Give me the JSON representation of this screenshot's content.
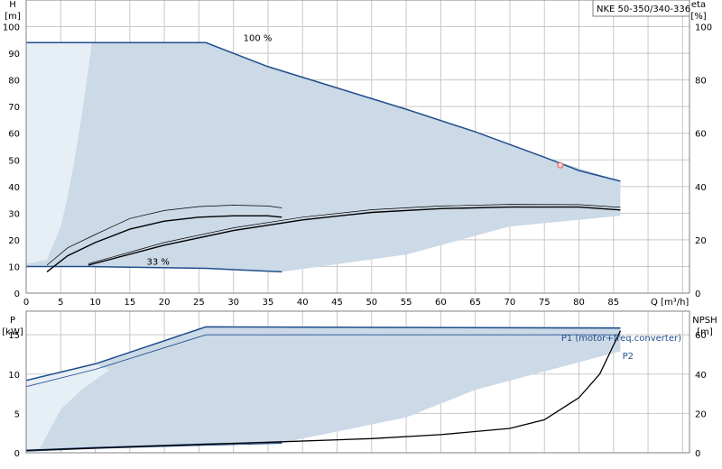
{
  "chart_data": [
    {
      "type": "area",
      "title": "NKE 50-350/340-336",
      "ylabel_unit": "[m]",
      "ylabel": "H",
      "xlabel": "Q [m³/h]",
      "right_ylabel": "eta",
      "right_ylabel_unit": "[%]",
      "xlim": [
        0,
        96
      ],
      "ylim": [
        0,
        110
      ],
      "right_ylim": [
        0,
        110
      ],
      "x_ticks": [
        0,
        5,
        10,
        15,
        20,
        25,
        30,
        35,
        40,
        45,
        50,
        55,
        60,
        65,
        70,
        75,
        80,
        85
      ],
      "y_ticks": [
        0,
        10,
        20,
        30,
        40,
        50,
        60,
        70,
        80,
        90,
        100
      ],
      "right_ticks": [
        0,
        20,
        40,
        60,
        80,
        100
      ],
      "grid": true,
      "annotations": [
        {
          "text": "100 %",
          "x": 33,
          "y": 96
        },
        {
          "text": "33 %",
          "x": 19,
          "y": 12
        }
      ],
      "operating_point": {
        "x": 77.3,
        "y": 48
      },
      "series": [
        {
          "role": "envelope",
          "points": [
            [
              0,
              94
            ],
            [
              26,
              94
            ],
            [
              35,
              85
            ],
            [
              45,
              77
            ],
            [
              55,
              69
            ],
            [
              65,
              60.5
            ],
            [
              75,
              51
            ],
            [
              86,
              42
            ],
            [
              86,
              29
            ],
            [
              70,
              25
            ],
            [
              55,
              14.5
            ],
            [
              37,
              8
            ],
            [
              26,
              9.3
            ],
            [
              9,
              10
            ],
            [
              0,
              10
            ]
          ]
        },
        {
          "role": "envelope_light",
          "points": [
            [
              0,
              94
            ],
            [
              9.5,
              94
            ],
            [
              9,
              84
            ],
            [
              8,
              66
            ],
            [
              7,
              50
            ],
            [
              6,
              36
            ],
            [
              5,
              25
            ],
            [
              3,
              12.5
            ],
            [
              0,
              11
            ]
          ]
        },
        {
          "role": "head_max",
          "points": [
            [
              0,
              94
            ],
            [
              26,
              94
            ],
            [
              35,
              85
            ],
            [
              45,
              77
            ],
            [
              55,
              69
            ],
            [
              65,
              60.5
            ],
            [
              75,
              51
            ],
            [
              80,
              46
            ],
            [
              86,
              42
            ]
          ]
        },
        {
          "role": "head_min",
          "points": [
            [
              0,
              10
            ],
            [
              9,
              10
            ],
            [
              26,
              9.3
            ],
            [
              37,
              8
            ]
          ]
        },
        {
          "role": "eta_max",
          "points": [
            [
              9,
              10.5
            ],
            [
              20,
              18
            ],
            [
              30,
              23.5
            ],
            [
              40,
              27.5
            ],
            [
              50,
              30.3
            ],
            [
              60,
              31.7
            ],
            [
              70,
              32.3
            ],
            [
              80,
              32.3
            ],
            [
              86,
              31.2
            ]
          ]
        },
        {
          "role": "eta_max_thin",
          "points": [
            [
              9,
              11
            ],
            [
              20,
              19
            ],
            [
              30,
              24.5
            ],
            [
              40,
              28.5
            ],
            [
              50,
              31.3
            ],
            [
              60,
              32.7
            ],
            [
              70,
              33.3
            ],
            [
              80,
              33.2
            ],
            [
              86,
              32.2
            ]
          ]
        },
        {
          "role": "eta_min",
          "points": [
            [
              3,
              8
            ],
            [
              6,
              14
            ],
            [
              10,
              19
            ],
            [
              15,
              24
            ],
            [
              20,
              27
            ],
            [
              25,
              28.5
            ],
            [
              30,
              29
            ],
            [
              35,
              29
            ],
            [
              37,
              28.5
            ]
          ]
        },
        {
          "role": "eta_min_thin",
          "points": [
            [
              3,
              10.5
            ],
            [
              6,
              17
            ],
            [
              10,
              22
            ],
            [
              15,
              28
            ],
            [
              20,
              31
            ],
            [
              25,
              32.5
            ],
            [
              30,
              33
            ],
            [
              35,
              32.7
            ],
            [
              37,
              32
            ]
          ]
        }
      ]
    },
    {
      "type": "area",
      "ylabel": "P",
      "ylabel_unit": "[kW]",
      "right_ylabel": "NPSH",
      "right_ylabel_unit": "[m]",
      "xlim": [
        0,
        96
      ],
      "ylim": [
        0,
        18
      ],
      "right_ylim": [
        0,
        72
      ],
      "y_ticks": [
        0,
        5,
        10,
        15
      ],
      "right_ticks": [
        0,
        20,
        40,
        60
      ],
      "grid": true,
      "legend": [
        "P1 (motor+freq.converter)",
        "P2"
      ],
      "series": [
        {
          "role": "envelope",
          "points": [
            [
              0,
              9.2
            ],
            [
              10,
              11.3
            ],
            [
              26,
              16
            ],
            [
              86,
              16
            ],
            [
              86,
              12.9
            ],
            [
              65,
              8
            ],
            [
              55,
              4.5
            ],
            [
              40,
              1.8
            ],
            [
              37,
              1.3
            ],
            [
              26,
              1.1
            ],
            [
              10,
              0.6
            ],
            [
              0,
              0.2
            ]
          ]
        },
        {
          "role": "envelope_light",
          "points": [
            [
              0,
              9.2
            ],
            [
              10,
              11.3
            ],
            [
              12,
              10.5
            ],
            [
              8,
              8
            ],
            [
              5,
              5.5
            ],
            [
              3.5,
              3
            ],
            [
              2,
              0.6
            ],
            [
              0,
              0.4
            ]
          ]
        },
        {
          "name": "P1 (motor+freq.converter)",
          "points": [
            [
              0,
              9.2
            ],
            [
              10,
              11.3
            ],
            [
              26,
              16
            ],
            [
              86,
              15.85
            ]
          ]
        },
        {
          "name": "P2",
          "points": [
            [
              0,
              8.4
            ],
            [
              10,
              10.6
            ],
            [
              26,
              15
            ],
            [
              86,
              15
            ]
          ]
        },
        {
          "role": "power_min_p1",
          "points": [
            [
              0,
              0.3
            ],
            [
              10,
              0.65
            ],
            [
              26,
              1.1
            ],
            [
              37,
              1.35
            ]
          ]
        },
        {
          "role": "power_min_p2",
          "points": [
            [
              0,
              0.2
            ],
            [
              10,
              0.55
            ],
            [
              26,
              0.95
            ],
            [
              37,
              1.2
            ]
          ]
        },
        {
          "role": "npsh",
          "points": [
            [
              0,
              0.3
            ],
            [
              10,
              0.6
            ],
            [
              20,
              0.9
            ],
            [
              37,
              1.4
            ],
            [
              50,
              1.8
            ],
            [
              60,
              2.3
            ],
            [
              70,
              3.1
            ],
            [
              75,
              4.2
            ],
            [
              80,
              7
            ],
            [
              83,
              10
            ],
            [
              86,
              15.5
            ]
          ]
        }
      ]
    }
  ]
}
